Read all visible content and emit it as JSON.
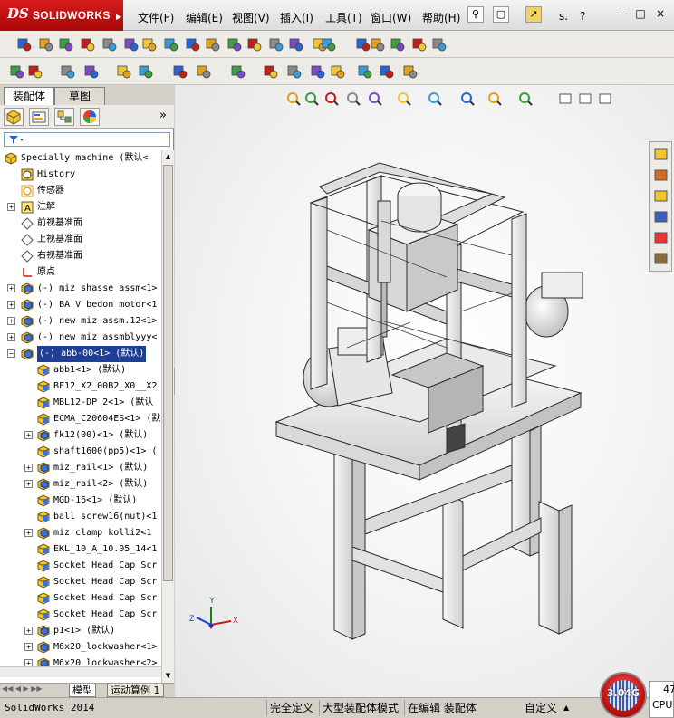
{
  "app": {
    "logo_prefix": "DS",
    "logo_text": "SOLIDWORKS",
    "logo_arrow": "▶",
    "brand_color": "#c4161c"
  },
  "menubar": {
    "items": [
      "文件(F)",
      "编辑(E)",
      "视图(V)",
      "插入(I)",
      "工具(T)",
      "窗口(W)",
      "帮助(H)"
    ],
    "search_text": "s.",
    "help_glyph": "?"
  },
  "window_controls": [
    "—",
    "□",
    "×"
  ],
  "left_panel": {
    "cm_tabs": [
      "装配体",
      "草图"
    ],
    "manager_tab_icons": [
      "featuremanager-icon",
      "propertymanager-icon",
      "configurationmanager-icon",
      "displaymanager-icon"
    ],
    "expand_arrow": "»",
    "filter_icon": "filter-icon",
    "tree": [
      {
        "label": "Specially machine  (默认<",
        "icon": "assembly-icon",
        "level": 0,
        "expand": ""
      },
      {
        "label": "History",
        "icon": "history-icon",
        "level": 1,
        "expand": ""
      },
      {
        "label": "传感器",
        "icon": "sensor-icon",
        "level": 1,
        "expand": ""
      },
      {
        "label": "注解",
        "icon": "annotation-icon",
        "level": 1,
        "expand": "+"
      },
      {
        "label": "前视基准面",
        "icon": "plane-icon",
        "level": 1,
        "expand": ""
      },
      {
        "label": "上视基准面",
        "icon": "plane-icon",
        "level": 1,
        "expand": ""
      },
      {
        "label": "右视基准面",
        "icon": "plane-icon",
        "level": 1,
        "expand": ""
      },
      {
        "label": "原点",
        "icon": "origin-icon",
        "level": 1,
        "expand": ""
      },
      {
        "label": "(-) miz shasse assm<1>",
        "icon": "subassembly-icon",
        "level": 1,
        "expand": "+"
      },
      {
        "label": "(-) BA V bedon motor<1",
        "icon": "subassembly-icon",
        "level": 1,
        "expand": "+"
      },
      {
        "label": "(-) new miz assm.12<1>",
        "icon": "subassembly-icon",
        "level": 1,
        "expand": "+"
      },
      {
        "label": "(-) new miz assmblyyy<",
        "icon": "subassembly-icon",
        "level": 1,
        "expand": "+"
      },
      {
        "label": "(-) abb-00<1> (默认)",
        "icon": "subassembly-icon",
        "level": 1,
        "expand": "−",
        "selected": true
      },
      {
        "label": "abb1<1> (默认)",
        "icon": "part-icon",
        "level": 2,
        "expand": ""
      },
      {
        "label": "BF12_X2_00B2_X0__X2",
        "icon": "part-icon",
        "level": 2,
        "expand": ""
      },
      {
        "label": "MBL12-DP_2<1> (默认",
        "icon": "part-icon",
        "level": 2,
        "expand": ""
      },
      {
        "label": "ECMA_C20604ES<1> (默",
        "icon": "part-icon",
        "level": 2,
        "expand": ""
      },
      {
        "label": "fk12(00)<1> (默认)",
        "icon": "subassembly-icon",
        "level": 2,
        "expand": "+"
      },
      {
        "label": "shaft1600(pp5)<1> (",
        "icon": "part-icon",
        "level": 2,
        "expand": ""
      },
      {
        "label": "miz_rail<1> (默认)",
        "icon": "subassembly-icon",
        "level": 2,
        "expand": "+"
      },
      {
        "label": "miz_rail<2> (默认)",
        "icon": "subassembly-icon",
        "level": 2,
        "expand": "+"
      },
      {
        "label": "MGD-16<1> (默认)",
        "icon": "part-icon",
        "level": 2,
        "expand": ""
      },
      {
        "label": "ball screw16(nut)<1",
        "icon": "part-icon",
        "level": 2,
        "expand": ""
      },
      {
        "label": "miz clamp kolli2<1",
        "icon": "subassembly-icon",
        "level": 2,
        "expand": "+"
      },
      {
        "label": "EKL_10_A_10.05_14<1",
        "icon": "part-icon",
        "level": 2,
        "expand": ""
      },
      {
        "label": "Socket Head Cap Scr",
        "icon": "part-icon",
        "level": 2,
        "expand": ""
      },
      {
        "label": "Socket Head Cap Scr",
        "icon": "part-icon",
        "level": 2,
        "expand": ""
      },
      {
        "label": "Socket Head Cap Scr",
        "icon": "part-icon",
        "level": 2,
        "expand": ""
      },
      {
        "label": "Socket Head Cap Scr",
        "icon": "part-icon",
        "level": 2,
        "expand": ""
      },
      {
        "label": "p1<1> (默认)",
        "icon": "subassembly-icon",
        "level": 2,
        "expand": "+"
      },
      {
        "label": "M6x20_lockwasher<1>",
        "icon": "subassembly-icon",
        "level": 2,
        "expand": "+"
      },
      {
        "label": "M6x20 lockwasher<2>",
        "icon": "subassembly-icon",
        "level": 2,
        "expand": "+"
      }
    ]
  },
  "bottom_tabs": [
    "模型",
    "运动算例 1"
  ],
  "viewport": {
    "triad_labels": {
      "x": "X",
      "y": "Y",
      "z": "Z"
    },
    "background_color": "#f4f4f4",
    "model_color": "#e9e9e9"
  },
  "taskpane_icons": [
    "home-icon",
    "library-icon",
    "folder-icon",
    "view-palette-icon",
    "appearance-icon",
    "custom-properties-icon"
  ],
  "statusbar": {
    "app_version": "SolidWorks 2014",
    "fields": [
      "完全定义",
      "大型装配体模式",
      "在编辑 装配体",
      "自定义"
    ],
    "memory": "3.04G",
    "cpu_value": "47",
    "cpu_label": "CPU"
  }
}
